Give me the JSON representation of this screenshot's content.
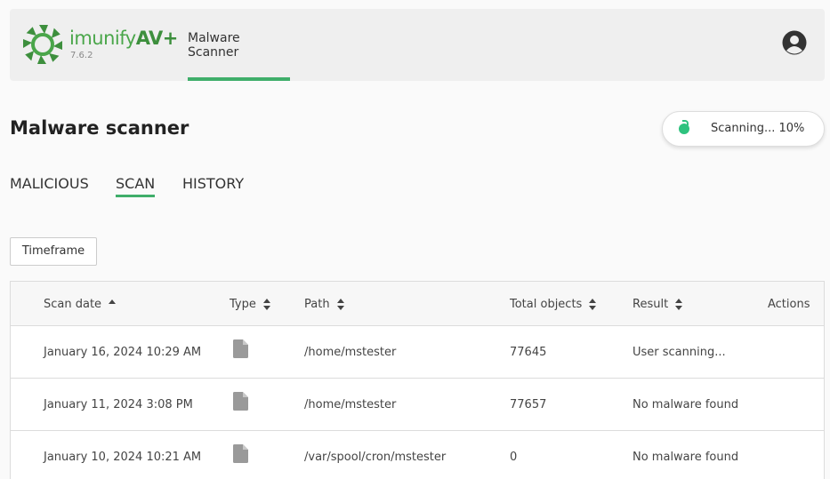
{
  "header": {
    "brand_name_prefix": "imunify",
    "brand_name_suffix": "AV+",
    "version": "7.6.2",
    "nav_tab": "Malware Scanner",
    "accent_color": "#3fae6a",
    "logo_icon": "imunify-logo-icon",
    "avatar_icon": "user-avatar-icon"
  },
  "page": {
    "title": "Malware scanner",
    "scan_status": "Scanning... 10%"
  },
  "tabs": [
    {
      "label": "MALICIOUS",
      "active": false
    },
    {
      "label": "SCAN",
      "active": true
    },
    {
      "label": "HISTORY",
      "active": false
    }
  ],
  "filters": {
    "timeframe_label": "Timeframe"
  },
  "table": {
    "columns": [
      {
        "label": "Scan date",
        "sort": "asc"
      },
      {
        "label": "Type",
        "sort": "both"
      },
      {
        "label": "Path",
        "sort": "both"
      },
      {
        "label": "Total objects",
        "sort": "both"
      },
      {
        "label": "Result",
        "sort": "both"
      },
      {
        "label": "Actions",
        "sort": "none"
      }
    ],
    "rows": [
      {
        "date": "January 16, 2024 10:29 AM",
        "type_icon": "file-icon",
        "path": "/home/mstester",
        "total": "77645",
        "result": "User scanning..."
      },
      {
        "date": "January 11, 2024 3:08 PM",
        "type_icon": "file-icon",
        "path": "/home/mstester",
        "total": "77657",
        "result": "No malware found"
      },
      {
        "date": "January 10, 2024 10:21 AM",
        "type_icon": "file-icon",
        "path": "/var/spool/cron/mstester",
        "total": "0",
        "result": "No malware found"
      }
    ]
  }
}
